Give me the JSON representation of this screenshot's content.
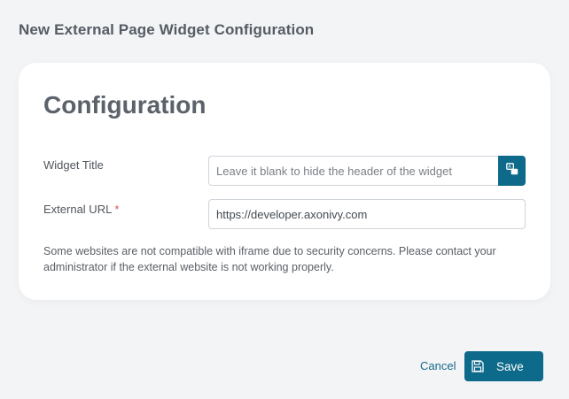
{
  "dialog": {
    "title": "New External Page Widget Configuration"
  },
  "card": {
    "title": "Configuration",
    "widget_title": {
      "label": "Widget Title",
      "placeholder": "Leave it blank to hide the header of the widget",
      "value": "",
      "translate_icon": "translate-icon"
    },
    "external_url": {
      "label": "External URL",
      "required_marker": "*",
      "value": "https://developer.axonivy.com"
    },
    "note": "Some websites are not compatible with iframe due to security concerns. Please contact your administrator if the external website is not working properly."
  },
  "footer": {
    "cancel_label": "Cancel",
    "save_label": "Save",
    "save_icon": "save-icon"
  },
  "colors": {
    "primary": "#0e6a8a",
    "required": "#d9534f",
    "background": "#f3f4f6",
    "card": "#ffffff"
  }
}
